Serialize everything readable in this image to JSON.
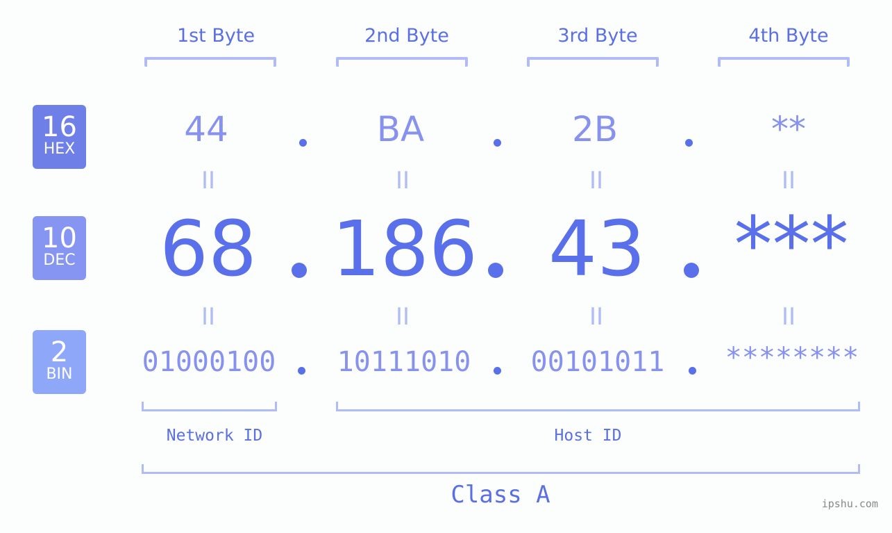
{
  "byte_headers": [
    "1st Byte",
    "2nd Byte",
    "3rd Byte",
    "4th Byte"
  ],
  "badges": [
    {
      "number": "16",
      "label": "HEX",
      "color": "#6f7fe8"
    },
    {
      "number": "10",
      "label": "DEC",
      "color": "#8595f1"
    },
    {
      "number": "2",
      "label": "BIN",
      "color": "#8fa7f8"
    }
  ],
  "hex": [
    "44",
    "BA",
    "2B",
    "**"
  ],
  "dec": [
    "68",
    "186",
    "43",
    "***"
  ],
  "bin": [
    "01000100",
    "10111010",
    "00101011",
    "********"
  ],
  "equals_symbol": "II",
  "network_id_label": "Network ID",
  "host_id_label": "Host ID",
  "class_label": "Class A",
  "watermark": "ipshu.com",
  "colors": {
    "accent": "#5970ea",
    "light_accent": "#8792ee",
    "bracket": "#b1bcf7",
    "background": "#fcfdfd"
  }
}
